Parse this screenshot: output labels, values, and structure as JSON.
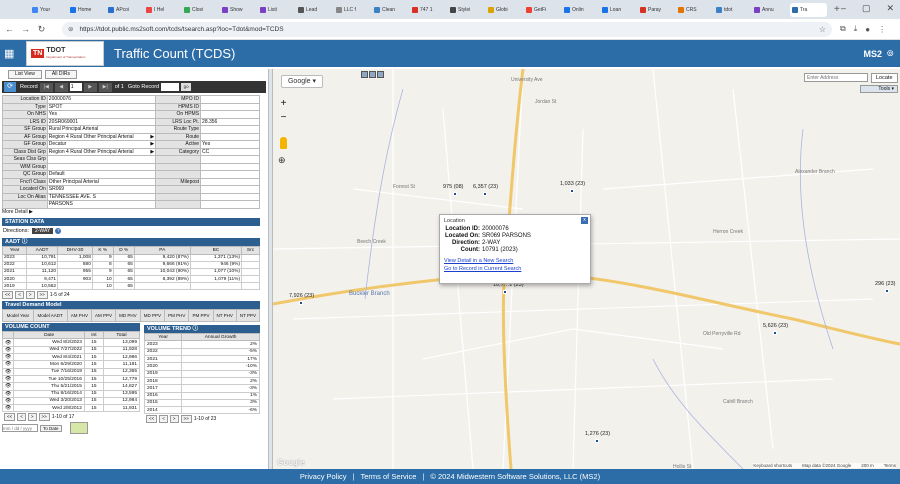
{
  "browser": {
    "tabs": [
      {
        "label": "Your",
        "color": "#4285f4"
      },
      {
        "label": "Home",
        "color": "#1a73e8"
      },
      {
        "label": "APcoi",
        "color": "#2a6fd0"
      },
      {
        "label": "I Hel",
        "color": "#e44"
      },
      {
        "label": "Closi",
        "color": "#34a853"
      },
      {
        "label": "Show",
        "color": "#7b3fc4"
      },
      {
        "label": "Listi",
        "color": "#7b3fc4"
      },
      {
        "label": "Lead",
        "color": "#555"
      },
      {
        "label": "LLC f",
        "color": "#888"
      },
      {
        "label": "Clean",
        "color": "#3b82c4"
      },
      {
        "label": "747 1",
        "color": "#d93025"
      },
      {
        "label": "Stylei",
        "color": "#444"
      },
      {
        "label": "Globi",
        "color": "#d9a400"
      },
      {
        "label": "GetFi",
        "color": "#ea4335"
      },
      {
        "label": "Onlin",
        "color": "#1a73e8"
      },
      {
        "label": "Loan",
        "color": "#1a73e8"
      },
      {
        "label": "Paray",
        "color": "#d93025"
      },
      {
        "label": "CRS",
        "color": "#e37400"
      },
      {
        "label": "tdot",
        "color": "#3b82c4"
      },
      {
        "label": "Annu",
        "color": "#7b3fc4"
      },
      {
        "label": "Tra",
        "color": "#2c6da8"
      }
    ],
    "new_tab": "+",
    "url": "https://tdot.public.ms2soft.com/tcds/tsearch.asp?loc=Tdot&mod=TCDS"
  },
  "app": {
    "logo_tn": "TN",
    "logo_name": "TDOT",
    "logo_sub": "Department of Transportation",
    "title": "Traffic Count (TCDS)",
    "brand": "MS2"
  },
  "left": {
    "view_tabs": [
      "List View",
      "All DIRs"
    ],
    "record_label": "Record",
    "record_num": "1",
    "of_text": "of 1",
    "goto_label": "Goto Record",
    "go": "go",
    "attributes": [
      {
        "k": "Location ID",
        "v": "20000076",
        "k2": "MPO ID",
        "v2": ""
      },
      {
        "k": "Type",
        "v": "SPOT",
        "k2": "HPMS ID",
        "v2": ""
      },
      {
        "k": "On NHS",
        "v": "Yes",
        "k2": "On HPMS",
        "v2": ""
      },
      {
        "k": "LRS ID",
        "v": "20SR069001",
        "k2": "LRS Loc Pt.",
        "v2": "28.356"
      },
      {
        "k": "SF Group",
        "v": "Rural Principal Arterial",
        "k2": "Route Type",
        "v2": ""
      },
      {
        "k": "AF Group",
        "v": "Region 4 Rural Other Principal Arterial",
        "k2": "Route",
        "v2": "",
        "arrow": true
      },
      {
        "k": "GF Group",
        "v": "Decatur",
        "k2": "Active",
        "v2": "Yes",
        "arrow": true
      },
      {
        "k": "Class Dist Grp",
        "v": "Region 4 Rural Other Principal Arterial",
        "k2": "Category",
        "v2": "CC",
        "arrow": true
      },
      {
        "k": "Seas Clss Grp",
        "v": "",
        "k2": "",
        "v2": ""
      },
      {
        "k": "WIM Group",
        "v": "",
        "k2": "",
        "v2": ""
      },
      {
        "k": "QC Group",
        "v": "Default",
        "k2": "",
        "v2": ""
      },
      {
        "k": "Fnct'l Class",
        "v": "Other Principal Arterial",
        "k2": "Milepost",
        "v2": ""
      },
      {
        "k": "Located On",
        "v": "SR069",
        "k2": "",
        "v2": ""
      },
      {
        "k": "Loc On Alias",
        "v": "TENNESSEE AVE. S",
        "k2": "",
        "v2": ""
      },
      {
        "k": "",
        "v": "PARSONS",
        "k2": "",
        "v2": ""
      }
    ],
    "more": "More Detail ▶",
    "station_data": "STATION DATA",
    "directions_label": "Directions:",
    "directions_value": "2-WAY",
    "aadt_title": "AADT",
    "aadt_headers": [
      "Year",
      "AADT",
      "DHV-30",
      "K %",
      "D %",
      "PA",
      "BC",
      "Src"
    ],
    "aadt_rows": [
      [
        "2023",
        "10,791",
        "1,008",
        "9",
        "65",
        "9,420 (87%)",
        "1,371 (13%)",
        ""
      ],
      [
        "2022",
        "10,612",
        "880",
        "8",
        "65",
        "9,666 (91%)",
        "946 (9%)",
        ""
      ],
      [
        "2021",
        "11,120",
        "955",
        "9",
        "65",
        "10,043 (90%)",
        "1,077 (10%)",
        ""
      ],
      [
        "2020",
        "9,471",
        "903",
        "10",
        "65",
        "8,392 (89%)",
        "1,079 (11%)",
        ""
      ],
      [
        "2019",
        "10,562",
        "",
        "10",
        "65",
        "",
        "",
        ""
      ]
    ],
    "aadt_pager": "1-5 of 24",
    "tdm_title": "Travel Demand Model",
    "tdm_headers": [
      "Model Year",
      "Model AADT",
      "AM PHV",
      "AM PPV",
      "MD PHV",
      "MD PPV",
      "PM PHV",
      "PM PPV",
      "NT PHV",
      "NT PPV"
    ],
    "vc_title": "VOLUME COUNT",
    "vc_headers": [
      "",
      "Date",
      "Int",
      "Total"
    ],
    "vc_rows": [
      [
        "Wed 8/2/2023",
        "15",
        "13,099"
      ],
      [
        "Wed 7/27/2022",
        "15",
        "11,928"
      ],
      [
        "Wed 8/4/2021",
        "15",
        "12,986"
      ],
      [
        "Mon 6/29/2020",
        "15",
        "11,181"
      ],
      [
        "Tue 7/16/2019",
        "15",
        "12,365"
      ],
      [
        "Tue 10/25/2016",
        "15",
        "12,779"
      ],
      [
        "Thu 5/21/2015",
        "15",
        "14,827"
      ],
      [
        "Thu 8/16/2014",
        "15",
        "13,595"
      ],
      [
        "Wed 3/20/2013",
        "15",
        "12,984"
      ],
      [
        "Wed 2/8/2012",
        "15",
        "11,931"
      ]
    ],
    "vc_pager": "1-10 of 17",
    "vc_date_placeholder": "mm / dd / yyyy",
    "vc_todate": "To Date",
    "vt_title": "VOLUME TREND",
    "vt_headers": [
      "Year",
      "Annual Growth"
    ],
    "vt_rows": [
      [
        "2023",
        "2%"
      ],
      [
        "2022",
        "-5%"
      ],
      [
        "2021",
        "17%"
      ],
      [
        "2020",
        "-10%"
      ],
      [
        "2019",
        "-3%"
      ],
      [
        "2018",
        "2%"
      ],
      [
        "2017",
        "-3%"
      ],
      [
        "2016",
        "1%"
      ],
      [
        "2015",
        "3%"
      ],
      [
        "2014",
        "-6%"
      ]
    ],
    "vt_pager": "1-10 of 23"
  },
  "map": {
    "google_sel": "Google ▾",
    "address_placeholder": "Enter Address",
    "locate": "Locate",
    "tools": "Tools ▾",
    "points": [
      {
        "label": "975 (08)"
      },
      {
        "label": "6,357 (23)"
      },
      {
        "label": "1,033 (23)"
      },
      {
        "label": "7,926 (23)"
      },
      {
        "label": "10,7…1 (23)"
      },
      {
        "label": "5,626 (23)"
      },
      {
        "label": "296 (23)"
      },
      {
        "label": "1,276 (23)"
      }
    ],
    "towns": [
      "University Ave",
      "Jordan St",
      "Forrest St",
      "Buckler Branch",
      "Beech Creek",
      "Herron Creek",
      "Old Perryville Rd",
      "Hollis St",
      "Alexander Branch",
      "Cahill Branch"
    ],
    "popup": {
      "title": "Location",
      "close": "x",
      "fields": [
        {
          "k": "Location ID:",
          "v": "20000076"
        },
        {
          "k": "Located On:",
          "v": "SR069 PARSONS"
        },
        {
          "k": "Direction:",
          "v": "2-WAY"
        },
        {
          "k": "Count:",
          "v": "10791 (2023)"
        }
      ],
      "link1": "View Detail in a New Search",
      "link2": "Go to Record in Current Search"
    },
    "attribution": [
      "Keyboard shortcuts",
      "Map data ©2024 Google",
      "200 m",
      "Terms"
    ],
    "glogo": "Google"
  },
  "footer": {
    "privacy": "Privacy Policy",
    "terms": "Terms of Service",
    "copyright": "© 2024 Midwestern Software Solutions, LLC (MS2)"
  }
}
